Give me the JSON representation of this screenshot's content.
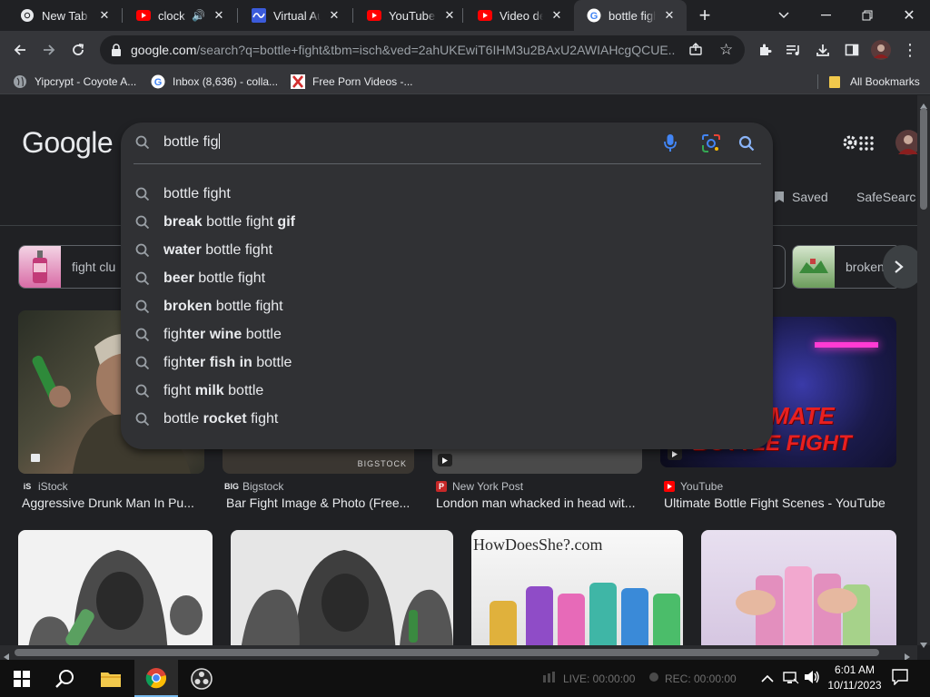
{
  "browser": {
    "tabs": [
      {
        "title": "New Tab",
        "icon": "chrome-icon",
        "active": false
      },
      {
        "title": "clock - ",
        "icon": "youtube-icon",
        "active": false,
        "audio": true
      },
      {
        "title": "Virtual Au",
        "icon": "virtual-audio-icon",
        "active": false
      },
      {
        "title": "YouTube",
        "icon": "youtube-icon",
        "active": false
      },
      {
        "title": "Video deta",
        "icon": "youtube-icon",
        "active": false
      },
      {
        "title": "bottle figh",
        "icon": "google-icon",
        "active": true
      }
    ],
    "new_tab_symbol": "+",
    "url_host": "google.com",
    "url_rest": "/search?q=bottle+fight&tbm=isch&ved=2ahUKEwiT6IHM3u2BAxU2AWIAHcgQCUE...",
    "bookmarks": [
      {
        "label": "Yipcrypt - Coyote A...",
        "icon": "globe-icon"
      },
      {
        "label": "Inbox (8,636) - colla...",
        "icon": "google-icon"
      },
      {
        "label": "Free Porn Videos -...",
        "icon": "x-logo-icon"
      }
    ],
    "all_bookmarks_label": "All Bookmarks"
  },
  "google": {
    "logo_text": "Google",
    "query": "bottle fig",
    "suggestions": [
      {
        "pre": "bottle fight",
        "bold": "",
        "post": ""
      },
      {
        "pre": "",
        "bold": "break",
        "post": " bottle fight ",
        "bold2": "gif"
      },
      {
        "pre": "",
        "bold": "water",
        "post": " bottle fight"
      },
      {
        "pre": "",
        "bold": "beer",
        "post": " bottle fight"
      },
      {
        "pre": "",
        "bold": "broken",
        "post": " bottle fight"
      },
      {
        "pre": "figh",
        "bold": "ter wine",
        "post": " bottle"
      },
      {
        "pre": "figh",
        "bold": "ter fish in",
        "post": " bottle"
      },
      {
        "pre": "fight ",
        "bold": "milk",
        "post": " bottle"
      },
      {
        "pre": "bottle ",
        "bold": "rocket",
        "post": " fight"
      }
    ],
    "saved_label": "Saved",
    "safesearch_label": "SafeSearc",
    "chips": [
      {
        "label": "fight clu"
      },
      {
        "label": "broken"
      }
    ],
    "results_row1": [
      {
        "source": "iStock",
        "caption": "Aggressive Drunk Man In Pu..."
      },
      {
        "source": "Bigstock",
        "caption": "Bar Fight Image & Photo (Free..."
      },
      {
        "source": "New York Post",
        "caption": "London man whacked in head wit..."
      },
      {
        "source": "YouTube",
        "caption": "Ultimate Bottle Fight Scenes - YouTube"
      }
    ],
    "overlay_texts": {
      "thumb4_line1": "MATE",
      "thumb4_line2": "BOTTLE FIGHT",
      "bigstock_mark": "BIGSTOCK",
      "howdoesshe": "HowDoesShe?.com"
    }
  },
  "taskbar": {
    "live_label": "LIVE: 00:00:00",
    "rec_label": "REC: 00:00:00",
    "time": "6:01 AM",
    "date": "10/11/2023"
  }
}
